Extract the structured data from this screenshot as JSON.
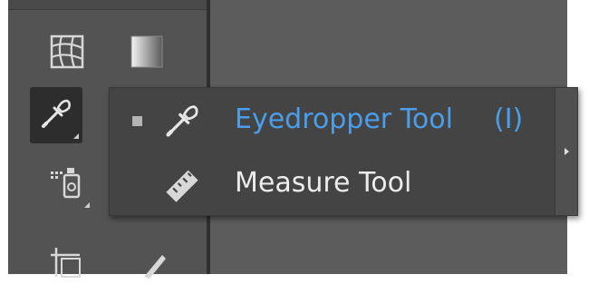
{
  "colors": {
    "accent": "#4a9eea",
    "menu_text": "#ececec",
    "panel_bg": "#444444",
    "toolbar_bg": "#535353",
    "workspace_bg": "#5c5c5c"
  },
  "toolbar": {
    "tools": [
      {
        "icon": "mesh-icon",
        "selected": false,
        "has_subtools": false
      },
      {
        "icon": "gradient-icon",
        "selected": false,
        "has_subtools": false
      },
      {
        "icon": "eyedropper-icon",
        "selected": true,
        "has_subtools": true
      },
      {
        "icon": "blend-icon",
        "selected": false,
        "has_subtools": false
      },
      {
        "icon": "symbol-sprayer-icon",
        "selected": false,
        "has_subtools": true
      },
      {
        "icon": "column-graph-icon",
        "selected": false,
        "has_subtools": true
      },
      {
        "icon": "artboard-icon",
        "selected": false,
        "has_subtools": false
      },
      {
        "icon": "slice-icon",
        "selected": false,
        "has_subtools": false
      }
    ]
  },
  "flyout": {
    "items": [
      {
        "label": "Eyedropper Tool",
        "shortcut": "(I)",
        "icon": "eyedropper-icon",
        "active": true
      },
      {
        "label": "Measure Tool",
        "shortcut": "",
        "icon": "ruler-icon",
        "active": false
      }
    ],
    "tearoff_icon": "chevron-right-icon"
  }
}
